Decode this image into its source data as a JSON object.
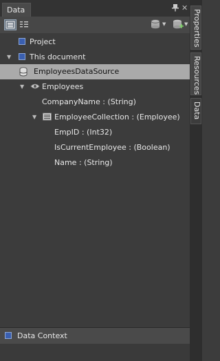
{
  "panel": {
    "title": "Data"
  },
  "side_tabs": [
    "Properties",
    "Resources",
    "Data"
  ],
  "tree": {
    "project": "Project",
    "this_document": "This document",
    "data_source": "EmployeesDataSource",
    "employees": "Employees",
    "company_name": "CompanyName : (String)",
    "employee_collection": "EmployeeCollection : (Employee)",
    "emp_id": "EmpID : (Int32)",
    "is_current_employee": "IsCurrentEmployee : (Boolean)",
    "name": "Name : (String)"
  },
  "bottom": {
    "data_context": "Data Context"
  },
  "colors": {
    "selected_row": "#aaaaaa",
    "panel_bg": "#3c3c3c",
    "accent_square": "#3a5fb0"
  },
  "icons": [
    "pin-icon",
    "close-icon",
    "list-mode-icon",
    "details-mode-icon",
    "add-data-source-icon",
    "add-live-data-icon",
    "database-icon",
    "eye-icon",
    "collection-icon"
  ]
}
